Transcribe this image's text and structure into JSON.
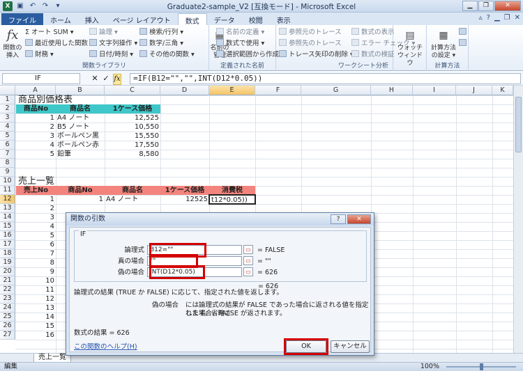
{
  "window": {
    "app_icon": "X",
    "title": "Graduate2-sample_V2 [互換モード] - Microsoft Excel"
  },
  "ribbon_tabs": [
    "ファイル",
    "ホーム",
    "挿入",
    "ページ レイアウト",
    "数式",
    "データ",
    "校閲",
    "表示"
  ],
  "active_tab": "数式",
  "ribbon": {
    "insert_function": "関数の\n挿入",
    "autosum": "Σ オート SUM ▾",
    "recent": "最近使用した関数 ▾",
    "financial": "財務 ▾",
    "logical": "論理 ▾",
    "text": "文字列操作 ▾",
    "datetime": "日付/時刻 ▾",
    "lookup": "検索/行列 ▾",
    "math": "数学/三角 ▾",
    "more": "その他の関数 ▾",
    "group_library": "関数ライブラリ",
    "name_manager": "名前の\n管理",
    "define_name": "名前の定義 ▾",
    "use_in_formula": "数式で使用 ▾",
    "create_from_selection": "選択範囲から作成",
    "group_names": "定義された名前",
    "trace_precedents": "参照元のトレース",
    "trace_dependents": "参照先のトレース",
    "remove_arrows": "トレース矢印の削除 ▾",
    "show_formulas": "数式の表示",
    "error_check": "エラー チェック ▾",
    "evaluate": "数式の検証",
    "group_audit": "ワークシート分析",
    "watch_window": "ウォッチ\nウィンドウ",
    "calc_options": "計算方法\nの設定 ▾",
    "group_calc": "計算方法"
  },
  "formula_bar": {
    "name_box": "IF",
    "formula": "=IF(B12=\"\",\"\",INT(D12*0.05))"
  },
  "columns": [
    "A",
    "B",
    "C",
    "D",
    "E",
    "F",
    "G",
    "H",
    "I",
    "J",
    "K"
  ],
  "rows": [
    "1",
    "2",
    "3",
    "4",
    "5",
    "6",
    "7",
    "8",
    "9",
    "10",
    "11",
    "12",
    "13",
    "14",
    "15",
    "16",
    "17",
    "18",
    "19",
    "20",
    "21",
    "22",
    "23",
    "24",
    "25",
    "26",
    "27"
  ],
  "sheet": {
    "price_title": "商品別価格表",
    "price_headers": [
      "商品No",
      "商品名",
      "1ケース価格"
    ],
    "price_rows": [
      {
        "no": "1",
        "name": "A4 ノート",
        "price": "12,525"
      },
      {
        "no": "2",
        "name": "B5 ノート",
        "price": "10,550"
      },
      {
        "no": "3",
        "name": "ボールペン黒",
        "price": "15,550"
      },
      {
        "no": "4",
        "name": "ボールペン赤",
        "price": "17,550"
      },
      {
        "no": "5",
        "name": "鉛筆",
        "price": "8,580"
      }
    ],
    "sales_title": "売上一覧",
    "sales_headers": [
      "売上No",
      "商品No",
      "商品名",
      "1ケース価格",
      "消費税"
    ],
    "sales_row12": {
      "sale_no": "1",
      "product_no": "1",
      "name": "A4 ノート",
      "price": "12525",
      "tax_edit": "t12*0.05))"
    },
    "sales_nos": [
      "2",
      "3",
      "4",
      "5",
      "6",
      "7",
      "8",
      "9",
      "10",
      "11",
      "12",
      "13",
      "14",
      "15",
      "16"
    ],
    "sheet_tab": "売上一覧"
  },
  "status": {
    "mode": "編集",
    "zoom": "100%"
  },
  "dialog": {
    "title": "関数の引数",
    "help_btn": "?",
    "close_btn": "✕",
    "function_name": "IF",
    "args": [
      {
        "label": "論理式",
        "value": "B12=\"\"",
        "result": "=  FALSE"
      },
      {
        "label": "真の場合",
        "value": "\"\"",
        "result": "=  \"\""
      },
      {
        "label": "偽の場合",
        "value": "INT(D12*0.05)",
        "result": "=  626"
      }
    ],
    "overall_result": "=  626",
    "description": "論理式の結果 (TRUE か FALSE) に応じて、指定された値を返します。",
    "arg_help_label": "偽の場合",
    "arg_help_text_1": "には論理式の結果が FALSE であった場合に返される値を指定します。省略さ",
    "arg_help_text_2": "れた場合、FALSE が返されます。",
    "formula_result": "数式の結果 =  626",
    "help_link": "この関数のヘルプ(H)",
    "ok": "OK",
    "cancel": "キャンセル"
  },
  "colors": {
    "teal_header": "#3fc7c9",
    "red_header": "#f2847d",
    "highlight": "#d40000"
  }
}
